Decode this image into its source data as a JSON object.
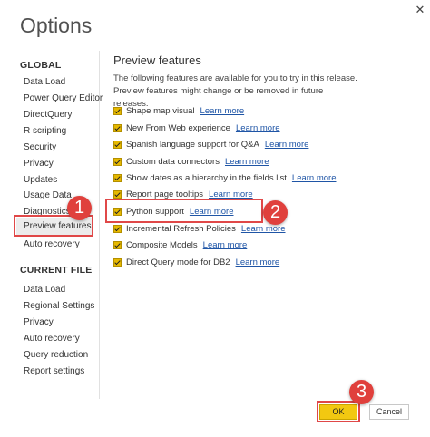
{
  "window": {
    "title": "Options",
    "close_glyph": "✕"
  },
  "sidebar": {
    "global_heading": "GLOBAL",
    "global_items": [
      {
        "label": "Data Load"
      },
      {
        "label": "Power Query Editor"
      },
      {
        "label": "DirectQuery"
      },
      {
        "label": "R scripting"
      },
      {
        "label": "Security"
      },
      {
        "label": "Privacy"
      },
      {
        "label": "Updates"
      },
      {
        "label": "Usage Data"
      },
      {
        "label": "Diagnostics"
      },
      {
        "label": "Preview features",
        "selected": true
      },
      {
        "label": "Auto recovery"
      }
    ],
    "current_file_heading": "CURRENT FILE",
    "current_file_items": [
      {
        "label": "Data Load"
      },
      {
        "label": "Regional Settings"
      },
      {
        "label": "Privacy"
      },
      {
        "label": "Auto recovery"
      },
      {
        "label": "Query reduction"
      },
      {
        "label": "Report settings"
      }
    ]
  },
  "main": {
    "title": "Preview features",
    "description": "The following features are available for you to try in this release. Preview features might change or be removed in future releases.",
    "features": [
      {
        "label": "Shape map visual",
        "link": "Learn more",
        "checked": true
      },
      {
        "label": "New From Web experience",
        "link": "Learn more",
        "checked": true
      },
      {
        "label": "Spanish language support for Q&A",
        "link": "Learn more",
        "checked": true
      },
      {
        "label": "Custom data connectors",
        "link": "Learn more",
        "checked": true
      },
      {
        "label": "Show dates as a hierarchy in the fields list",
        "link": "Learn more",
        "checked": true
      },
      {
        "label": "Report page tooltips",
        "link": "Learn more",
        "checked": true
      },
      {
        "label": "Python support",
        "link": "Learn more",
        "checked": true
      },
      {
        "label": "Incremental Refresh Policies",
        "link": "Learn more",
        "checked": true
      },
      {
        "label": "Composite Models",
        "link": "Learn more",
        "checked": true
      },
      {
        "label": "Direct Query mode for DB2",
        "link": "Learn more",
        "checked": true
      }
    ]
  },
  "footer": {
    "ok_label": "OK",
    "cancel_label": "Cancel"
  },
  "annotations": {
    "badge_1": "1",
    "badge_2": "2",
    "badge_3": "3"
  },
  "colors": {
    "checkbox": "#e6b800",
    "link": "#1f55a6",
    "ok_button": "#f2c811",
    "annotation": "#e04848"
  }
}
